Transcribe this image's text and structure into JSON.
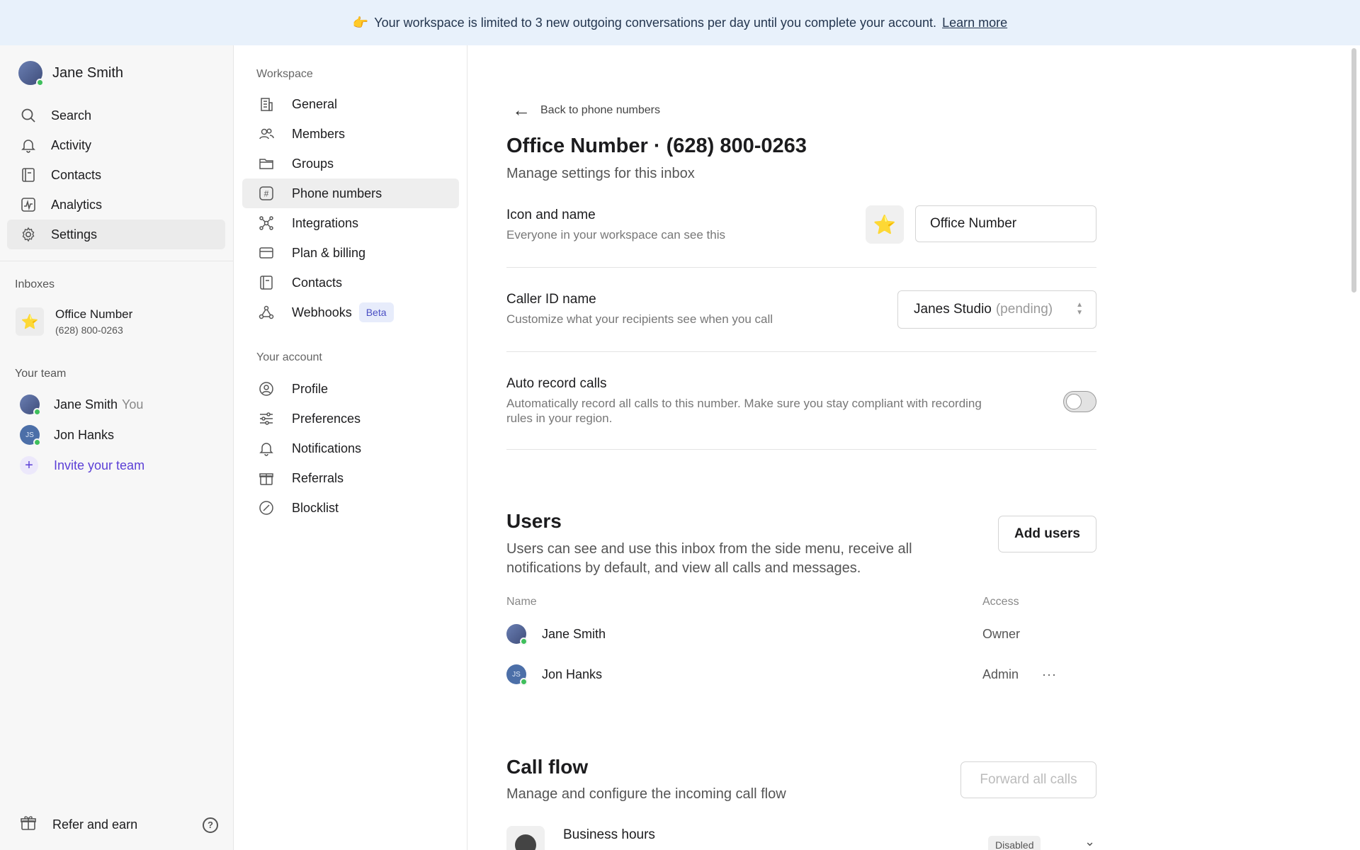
{
  "banner": {
    "emoji": "👉",
    "text": "Your workspace is limited to 3 new outgoing conversations per day until you complete your account.",
    "link": "Learn more"
  },
  "sidebar": {
    "user_name": "Jane Smith",
    "nav": [
      {
        "label": "Search",
        "icon": "search-icon"
      },
      {
        "label": "Activity",
        "icon": "bell-icon"
      },
      {
        "label": "Contacts",
        "icon": "contacts-icon"
      },
      {
        "label": "Analytics",
        "icon": "analytics-icon"
      },
      {
        "label": "Settings",
        "icon": "gear-icon",
        "active": true
      }
    ],
    "inboxes_label": "Inboxes",
    "inbox": {
      "name": "Office Number",
      "number": "(628) 800-0263",
      "icon": "⭐"
    },
    "team_label": "Your team",
    "team": [
      {
        "name": "Jane Smith",
        "suffix": "You"
      },
      {
        "name": "Jon Hanks",
        "initials": "JS"
      }
    ],
    "invite_label": "Invite your team",
    "refer_label": "Refer and earn"
  },
  "settings_menu": {
    "workspace_label": "Workspace",
    "workspace_items": [
      {
        "label": "General",
        "icon": "building-icon"
      },
      {
        "label": "Members",
        "icon": "members-icon"
      },
      {
        "label": "Groups",
        "icon": "folder-icon"
      },
      {
        "label": "Phone numbers",
        "icon": "hash-icon",
        "active": true
      },
      {
        "label": "Integrations",
        "icon": "integrations-icon"
      },
      {
        "label": "Plan & billing",
        "icon": "card-icon"
      },
      {
        "label": "Contacts",
        "icon": "contacts-icon"
      },
      {
        "label": "Webhooks",
        "icon": "webhooks-icon",
        "badge": "Beta"
      }
    ],
    "account_label": "Your account",
    "account_items": [
      {
        "label": "Profile",
        "icon": "profile-icon"
      },
      {
        "label": "Preferences",
        "icon": "sliders-icon"
      },
      {
        "label": "Notifications",
        "icon": "bell-icon"
      },
      {
        "label": "Referrals",
        "icon": "gift-icon"
      },
      {
        "label": "Blocklist",
        "icon": "block-icon"
      }
    ]
  },
  "main": {
    "back_label": "Back to phone numbers",
    "title": "Office Number · (628) 800-0263",
    "subtitle": "Manage settings for this inbox",
    "icon_name": {
      "label": "Icon and name",
      "desc": "Everyone in your workspace can see this",
      "icon": "⭐",
      "value": "Office Number"
    },
    "caller_id": {
      "label": "Caller ID name",
      "desc": "Customize what your recipients see when you call",
      "value": "Janes Studio",
      "status": "(pending)"
    },
    "auto_record": {
      "label": "Auto record calls",
      "desc1": "Automatically record all calls to this number. Make sure you stay compliant with recording",
      "desc2": "rules in your region.",
      "enabled": false
    },
    "users": {
      "title": "Users",
      "desc1": "Users can see and use this inbox from the side menu, receive all",
      "desc2": "notifications by default, and view all calls and messages.",
      "add_button": "Add users",
      "col_name": "Name",
      "col_access": "Access",
      "rows": [
        {
          "name": "Jane Smith",
          "access": "Owner"
        },
        {
          "name": "Jon Hanks",
          "access": "Admin",
          "initials": "JS"
        }
      ]
    },
    "call_flow": {
      "title": "Call flow",
      "desc": "Manage and configure the incoming call flow",
      "forward_button": "Forward all calls",
      "business_hours": "Business hours",
      "business_status": "Disabled"
    }
  }
}
